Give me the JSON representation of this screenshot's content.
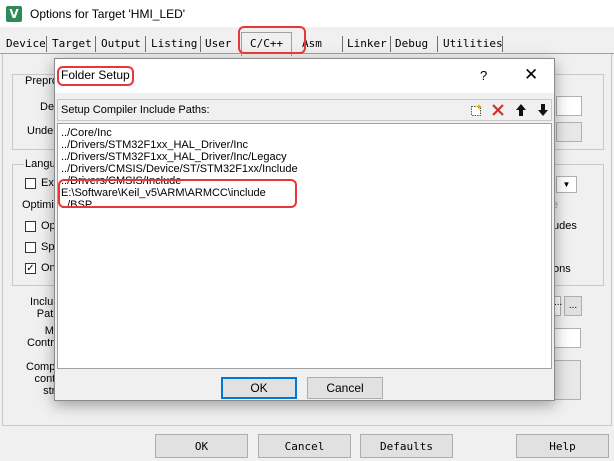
{
  "window": {
    "title": "Options for Target 'HMI_LED'",
    "icon_glyph": "V"
  },
  "tabs": [
    {
      "label": "Device"
    },
    {
      "label": "Target"
    },
    {
      "label": "Output"
    },
    {
      "label": "Listing"
    },
    {
      "label": "User"
    },
    {
      "label": "C/C++"
    },
    {
      "label": "Asm"
    },
    {
      "label": "Linker"
    },
    {
      "label": "Debug"
    },
    {
      "label": "Utilities"
    }
  ],
  "background": {
    "preprocessor_group": "Prepro",
    "define_label": "Def",
    "undefine_label": "Unde",
    "language_group": "Langu",
    "optimization_label": "Optimiz",
    "cb_labels": [
      "Ex",
      "Op",
      "Sp",
      "On"
    ],
    "include_paths_label": "Inclu\nPat",
    "misc_label": "M\nContr",
    "compiler_label": "Comp\ncont\nstr",
    "right_fragments": [
      "e",
      "udes",
      "ons"
    ],
    "browse_button": "...",
    "browse_button_left": "..."
  },
  "buttons": {
    "ok": "OK",
    "cancel": "Cancel",
    "defaults": "Defaults",
    "help": "Help"
  },
  "dialog": {
    "title": "Folder Setup",
    "help_glyph": "?",
    "close_glyph": "✕",
    "header_label": "Setup Compiler Include Paths:",
    "toolbar": {
      "new_icon": "new-folder-icon",
      "delete_icon": "delete-icon",
      "up_icon": "move-up-icon",
      "down_icon": "move-down-icon"
    },
    "paths": [
      "../Core/Inc",
      "../Drivers/STM32F1xx_HAL_Driver/Inc",
      "../Drivers/STM32F1xx_HAL_Driver/Inc/Legacy",
      "../Drivers/CMSIS/Device/ST/STM32F1xx/Include",
      "../Drivers/CMSIS/Include",
      "E:\\Software\\Keil_v5\\ARM\\ARMCC\\include",
      "../BSP"
    ],
    "ok": "OK",
    "cancel": "Cancel"
  },
  "colors": {
    "highlight": "#e53935",
    "delete_red": "#d32f2f",
    "focus_blue": "#0078d7"
  }
}
